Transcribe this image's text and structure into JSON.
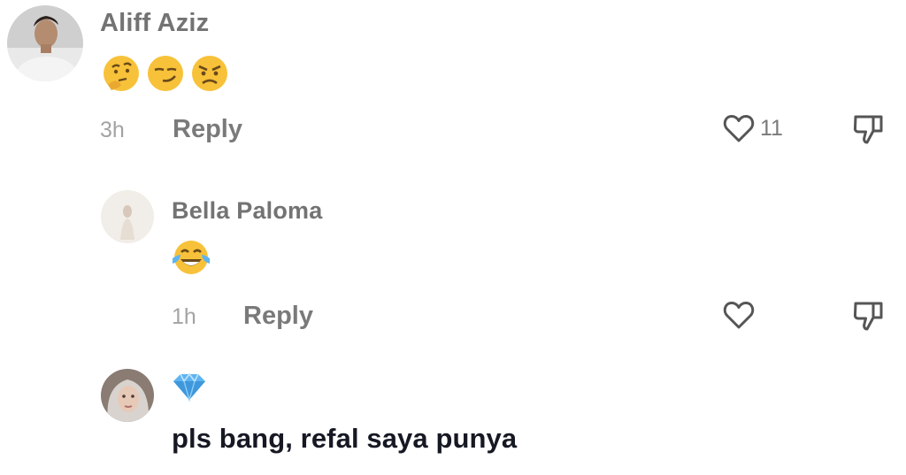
{
  "comments": [
    {
      "username": "Aliff Aziz",
      "emojis": [
        "thinking-face",
        "smirking-face",
        "angry-face"
      ],
      "time": "3h",
      "reply_label": "Reply",
      "like_count": "11",
      "icons": {
        "like": "heart-outline-icon",
        "dislike": "thumbs-down-icon"
      }
    },
    {
      "username": "Bella Paloma",
      "emojis": [
        "face-with-tears-of-joy"
      ],
      "time": "1h",
      "reply_label": "Reply",
      "like_count": "",
      "icons": {
        "like": "heart-outline-icon",
        "dislike": "thumbs-down-icon"
      }
    },
    {
      "username_emoji": "gem-stone",
      "text": "pls bang, refal saya punya"
    }
  ],
  "colors": {
    "username": "#737373",
    "meta": "#a3a3a3",
    "reply": "#7a7a7a",
    "comment_text": "#161823",
    "icon": "#555555",
    "emoji_yellow": "#f7c23a",
    "gem_blue": "#5fb4f0"
  }
}
